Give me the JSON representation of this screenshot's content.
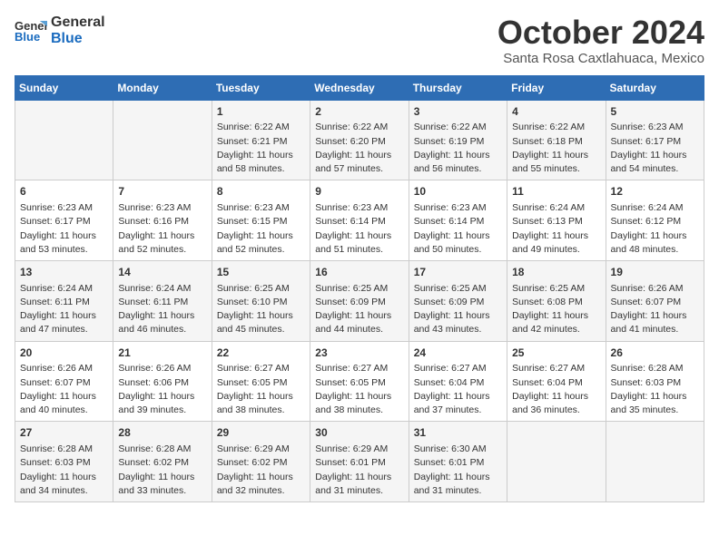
{
  "header": {
    "logo_general": "General",
    "logo_blue": "Blue",
    "month": "October 2024",
    "location": "Santa Rosa Caxtlahuaca, Mexico"
  },
  "days_of_week": [
    "Sunday",
    "Monday",
    "Tuesday",
    "Wednesday",
    "Thursday",
    "Friday",
    "Saturday"
  ],
  "weeks": [
    [
      {
        "day": "",
        "sunrise": "",
        "sunset": "",
        "daylight": ""
      },
      {
        "day": "",
        "sunrise": "",
        "sunset": "",
        "daylight": ""
      },
      {
        "day": "1",
        "sunrise": "Sunrise: 6:22 AM",
        "sunset": "Sunset: 6:21 PM",
        "daylight": "Daylight: 11 hours and 58 minutes."
      },
      {
        "day": "2",
        "sunrise": "Sunrise: 6:22 AM",
        "sunset": "Sunset: 6:20 PM",
        "daylight": "Daylight: 11 hours and 57 minutes."
      },
      {
        "day": "3",
        "sunrise": "Sunrise: 6:22 AM",
        "sunset": "Sunset: 6:19 PM",
        "daylight": "Daylight: 11 hours and 56 minutes."
      },
      {
        "day": "4",
        "sunrise": "Sunrise: 6:22 AM",
        "sunset": "Sunset: 6:18 PM",
        "daylight": "Daylight: 11 hours and 55 minutes."
      },
      {
        "day": "5",
        "sunrise": "Sunrise: 6:23 AM",
        "sunset": "Sunset: 6:17 PM",
        "daylight": "Daylight: 11 hours and 54 minutes."
      }
    ],
    [
      {
        "day": "6",
        "sunrise": "Sunrise: 6:23 AM",
        "sunset": "Sunset: 6:17 PM",
        "daylight": "Daylight: 11 hours and 53 minutes."
      },
      {
        "day": "7",
        "sunrise": "Sunrise: 6:23 AM",
        "sunset": "Sunset: 6:16 PM",
        "daylight": "Daylight: 11 hours and 52 minutes."
      },
      {
        "day": "8",
        "sunrise": "Sunrise: 6:23 AM",
        "sunset": "Sunset: 6:15 PM",
        "daylight": "Daylight: 11 hours and 52 minutes."
      },
      {
        "day": "9",
        "sunrise": "Sunrise: 6:23 AM",
        "sunset": "Sunset: 6:14 PM",
        "daylight": "Daylight: 11 hours and 51 minutes."
      },
      {
        "day": "10",
        "sunrise": "Sunrise: 6:23 AM",
        "sunset": "Sunset: 6:14 PM",
        "daylight": "Daylight: 11 hours and 50 minutes."
      },
      {
        "day": "11",
        "sunrise": "Sunrise: 6:24 AM",
        "sunset": "Sunset: 6:13 PM",
        "daylight": "Daylight: 11 hours and 49 minutes."
      },
      {
        "day": "12",
        "sunrise": "Sunrise: 6:24 AM",
        "sunset": "Sunset: 6:12 PM",
        "daylight": "Daylight: 11 hours and 48 minutes."
      }
    ],
    [
      {
        "day": "13",
        "sunrise": "Sunrise: 6:24 AM",
        "sunset": "Sunset: 6:11 PM",
        "daylight": "Daylight: 11 hours and 47 minutes."
      },
      {
        "day": "14",
        "sunrise": "Sunrise: 6:24 AM",
        "sunset": "Sunset: 6:11 PM",
        "daylight": "Daylight: 11 hours and 46 minutes."
      },
      {
        "day": "15",
        "sunrise": "Sunrise: 6:25 AM",
        "sunset": "Sunset: 6:10 PM",
        "daylight": "Daylight: 11 hours and 45 minutes."
      },
      {
        "day": "16",
        "sunrise": "Sunrise: 6:25 AM",
        "sunset": "Sunset: 6:09 PM",
        "daylight": "Daylight: 11 hours and 44 minutes."
      },
      {
        "day": "17",
        "sunrise": "Sunrise: 6:25 AM",
        "sunset": "Sunset: 6:09 PM",
        "daylight": "Daylight: 11 hours and 43 minutes."
      },
      {
        "day": "18",
        "sunrise": "Sunrise: 6:25 AM",
        "sunset": "Sunset: 6:08 PM",
        "daylight": "Daylight: 11 hours and 42 minutes."
      },
      {
        "day": "19",
        "sunrise": "Sunrise: 6:26 AM",
        "sunset": "Sunset: 6:07 PM",
        "daylight": "Daylight: 11 hours and 41 minutes."
      }
    ],
    [
      {
        "day": "20",
        "sunrise": "Sunrise: 6:26 AM",
        "sunset": "Sunset: 6:07 PM",
        "daylight": "Daylight: 11 hours and 40 minutes."
      },
      {
        "day": "21",
        "sunrise": "Sunrise: 6:26 AM",
        "sunset": "Sunset: 6:06 PM",
        "daylight": "Daylight: 11 hours and 39 minutes."
      },
      {
        "day": "22",
        "sunrise": "Sunrise: 6:27 AM",
        "sunset": "Sunset: 6:05 PM",
        "daylight": "Daylight: 11 hours and 38 minutes."
      },
      {
        "day": "23",
        "sunrise": "Sunrise: 6:27 AM",
        "sunset": "Sunset: 6:05 PM",
        "daylight": "Daylight: 11 hours and 38 minutes."
      },
      {
        "day": "24",
        "sunrise": "Sunrise: 6:27 AM",
        "sunset": "Sunset: 6:04 PM",
        "daylight": "Daylight: 11 hours and 37 minutes."
      },
      {
        "day": "25",
        "sunrise": "Sunrise: 6:27 AM",
        "sunset": "Sunset: 6:04 PM",
        "daylight": "Daylight: 11 hours and 36 minutes."
      },
      {
        "day": "26",
        "sunrise": "Sunrise: 6:28 AM",
        "sunset": "Sunset: 6:03 PM",
        "daylight": "Daylight: 11 hours and 35 minutes."
      }
    ],
    [
      {
        "day": "27",
        "sunrise": "Sunrise: 6:28 AM",
        "sunset": "Sunset: 6:03 PM",
        "daylight": "Daylight: 11 hours and 34 minutes."
      },
      {
        "day": "28",
        "sunrise": "Sunrise: 6:28 AM",
        "sunset": "Sunset: 6:02 PM",
        "daylight": "Daylight: 11 hours and 33 minutes."
      },
      {
        "day": "29",
        "sunrise": "Sunrise: 6:29 AM",
        "sunset": "Sunset: 6:02 PM",
        "daylight": "Daylight: 11 hours and 32 minutes."
      },
      {
        "day": "30",
        "sunrise": "Sunrise: 6:29 AM",
        "sunset": "Sunset: 6:01 PM",
        "daylight": "Daylight: 11 hours and 31 minutes."
      },
      {
        "day": "31",
        "sunrise": "Sunrise: 6:30 AM",
        "sunset": "Sunset: 6:01 PM",
        "daylight": "Daylight: 11 hours and 31 minutes."
      },
      {
        "day": "",
        "sunrise": "",
        "sunset": "",
        "daylight": ""
      },
      {
        "day": "",
        "sunrise": "",
        "sunset": "",
        "daylight": ""
      }
    ]
  ]
}
